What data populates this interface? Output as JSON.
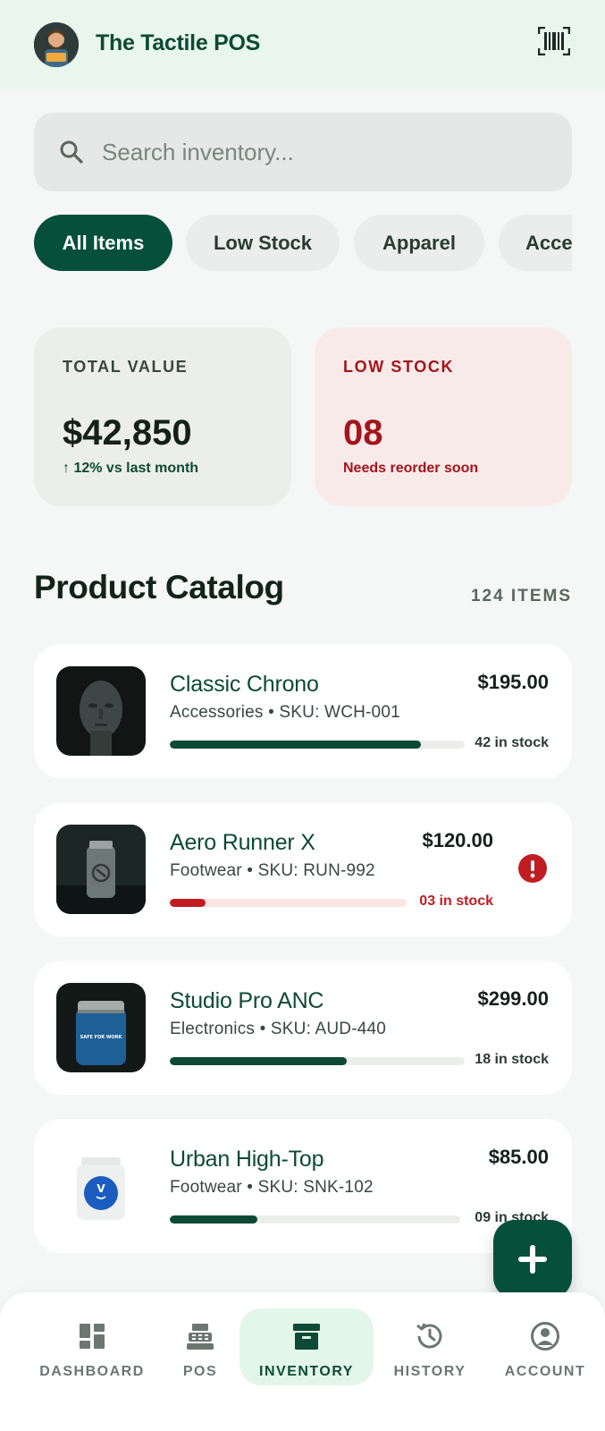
{
  "header": {
    "app_title": "The Tactile POS",
    "avatar_icon": "user-avatar",
    "scan_icon": "barcode-scan-icon"
  },
  "search": {
    "placeholder": "Search inventory...",
    "icon": "search-icon"
  },
  "filters": [
    {
      "label": "All Items",
      "active": true
    },
    {
      "label": "Low Stock",
      "active": false
    },
    {
      "label": "Apparel",
      "active": false
    },
    {
      "label": "Acce",
      "active": false
    }
  ],
  "stats": {
    "total_value": {
      "label": "TOTAL VALUE",
      "value": "$42,850",
      "sub": "↑ 12% vs last month"
    },
    "low_stock": {
      "label": "LOW STOCK",
      "value": "08",
      "sub": "Needs reorder soon"
    }
  },
  "catalog": {
    "title": "Product Catalog",
    "count": "124 ITEMS",
    "products": [
      {
        "name": "Classic Chrono",
        "meta": "Accessories • SKU: WCH-001",
        "price": "$195.00",
        "stock": "42 in stock",
        "stock_level": 0.85,
        "alert": false
      },
      {
        "name": "Aero Runner X",
        "meta": "Footwear • SKU: RUN-992",
        "price": "$120.00",
        "stock": "03 in stock",
        "stock_level": 0.15,
        "alert": true
      },
      {
        "name": "Studio Pro ANC",
        "meta": "Electronics • SKU: AUD-440",
        "price": "$299.00",
        "stock": "18 in stock",
        "stock_level": 0.6,
        "alert": false
      },
      {
        "name": "Urban High-Top",
        "meta": "Footwear • SKU: SNK-102",
        "price": "$85.00",
        "stock": "09 in stock",
        "stock_level": 0.3,
        "alert": false
      }
    ]
  },
  "fab": {
    "icon": "plus-icon"
  },
  "nav": [
    {
      "label": "DASHBOARD",
      "icon": "dashboard-icon",
      "active": false
    },
    {
      "label": "POS",
      "icon": "cash-register-icon",
      "active": false
    },
    {
      "label": "INVENTORY",
      "icon": "archive-box-icon",
      "active": true
    },
    {
      "label": "HISTORY",
      "icon": "history-icon",
      "active": false
    },
    {
      "label": "ACCOUNT",
      "icon": "account-circle-icon",
      "active": false
    }
  ],
  "colors": {
    "primary": "#0d4a35",
    "alert": "#c01c22",
    "background": "#f4f7f5"
  }
}
